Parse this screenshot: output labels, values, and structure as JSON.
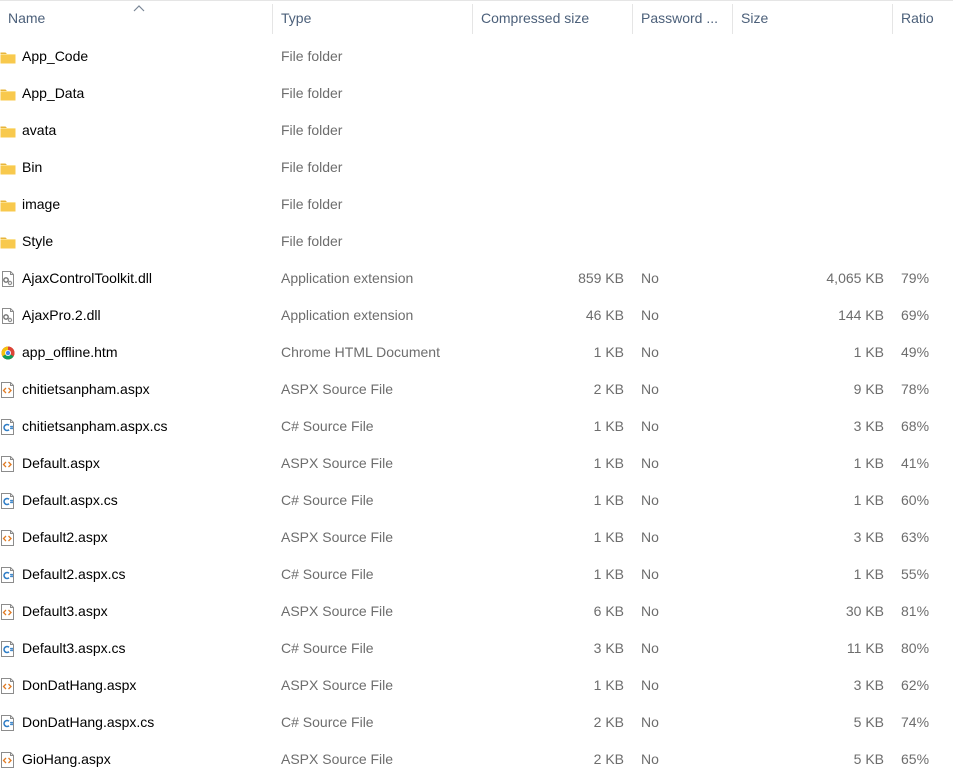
{
  "columns": {
    "name": "Name",
    "type": "Type",
    "compressed": "Compressed size",
    "password": "Password ...",
    "size": "Size",
    "ratio": "Ratio"
  },
  "sort": {
    "column": "name",
    "icon": "sort-up-icon"
  },
  "colors": {
    "header_text": "#4c607a",
    "secondary_text": "#6d6d6d",
    "folder": "#f8c94d",
    "divider": "#e5e5e5"
  },
  "rows": [
    {
      "name": "App_Code",
      "type": "File folder",
      "compressed": "",
      "password": "",
      "size": "",
      "ratio": "",
      "icon": "folder-icon"
    },
    {
      "name": "App_Data",
      "type": "File folder",
      "compressed": "",
      "password": "",
      "size": "",
      "ratio": "",
      "icon": "folder-icon"
    },
    {
      "name": "avata",
      "type": "File folder",
      "compressed": "",
      "password": "",
      "size": "",
      "ratio": "",
      "icon": "folder-icon"
    },
    {
      "name": "Bin",
      "type": "File folder",
      "compressed": "",
      "password": "",
      "size": "",
      "ratio": "",
      "icon": "folder-icon"
    },
    {
      "name": "image",
      "type": "File folder",
      "compressed": "",
      "password": "",
      "size": "",
      "ratio": "",
      "icon": "folder-icon"
    },
    {
      "name": "Style",
      "type": "File folder",
      "compressed": "",
      "password": "",
      "size": "",
      "ratio": "",
      "icon": "folder-icon"
    },
    {
      "name": "AjaxControlToolkit.dll",
      "type": "Application extension",
      "compressed": "859 KB",
      "password": "No",
      "size": "4,065 KB",
      "ratio": "79%",
      "icon": "dll-gear-icon"
    },
    {
      "name": "AjaxPro.2.dll",
      "type": "Application extension",
      "compressed": "46 KB",
      "password": "No",
      "size": "144 KB",
      "ratio": "69%",
      "icon": "dll-gear-icon"
    },
    {
      "name": "app_offline.htm",
      "type": "Chrome HTML Document",
      "compressed": "1 KB",
      "password": "No",
      "size": "1 KB",
      "ratio": "49%",
      "icon": "chrome-icon"
    },
    {
      "name": "chitietsanpham.aspx",
      "type": "ASPX Source File",
      "compressed": "2 KB",
      "password": "No",
      "size": "9 KB",
      "ratio": "78%",
      "icon": "aspx-file-icon"
    },
    {
      "name": "chitietsanpham.aspx.cs",
      "type": "C# Source File",
      "compressed": "1 KB",
      "password": "No",
      "size": "3 KB",
      "ratio": "68%",
      "icon": "csharp-file-icon"
    },
    {
      "name": "Default.aspx",
      "type": "ASPX Source File",
      "compressed": "1 KB",
      "password": "No",
      "size": "1 KB",
      "ratio": "41%",
      "icon": "aspx-file-icon"
    },
    {
      "name": "Default.aspx.cs",
      "type": "C# Source File",
      "compressed": "1 KB",
      "password": "No",
      "size": "1 KB",
      "ratio": "60%",
      "icon": "csharp-file-icon"
    },
    {
      "name": "Default2.aspx",
      "type": "ASPX Source File",
      "compressed": "1 KB",
      "password": "No",
      "size": "3 KB",
      "ratio": "63%",
      "icon": "aspx-file-icon"
    },
    {
      "name": "Default2.aspx.cs",
      "type": "C# Source File",
      "compressed": "1 KB",
      "password": "No",
      "size": "1 KB",
      "ratio": "55%",
      "icon": "csharp-file-icon"
    },
    {
      "name": "Default3.aspx",
      "type": "ASPX Source File",
      "compressed": "6 KB",
      "password": "No",
      "size": "30 KB",
      "ratio": "81%",
      "icon": "aspx-file-icon"
    },
    {
      "name": "Default3.aspx.cs",
      "type": "C# Source File",
      "compressed": "3 KB",
      "password": "No",
      "size": "11 KB",
      "ratio": "80%",
      "icon": "csharp-file-icon"
    },
    {
      "name": "DonDatHang.aspx",
      "type": "ASPX Source File",
      "compressed": "1 KB",
      "password": "No",
      "size": "3 KB",
      "ratio": "62%",
      "icon": "aspx-file-icon"
    },
    {
      "name": "DonDatHang.aspx.cs",
      "type": "C# Source File",
      "compressed": "2 KB",
      "password": "No",
      "size": "5 KB",
      "ratio": "74%",
      "icon": "csharp-file-icon"
    },
    {
      "name": "GioHang.aspx",
      "type": "ASPX Source File",
      "compressed": "2 KB",
      "password": "No",
      "size": "5 KB",
      "ratio": "65%",
      "icon": "aspx-file-icon"
    }
  ]
}
